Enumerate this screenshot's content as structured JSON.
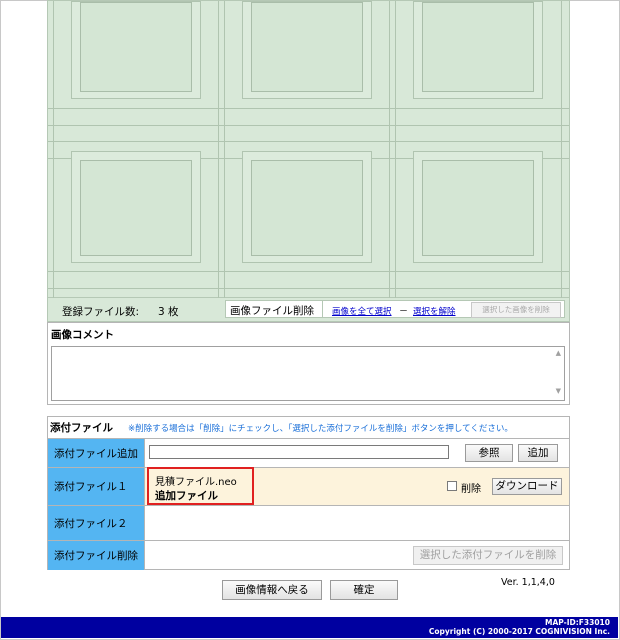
{
  "image_panel": {
    "count_label": "登録ファイル数:",
    "count_value": "3 枚",
    "delete_label": "画像ファイル削除",
    "select_all_link": "画像を全て選択",
    "separator": "－",
    "deselect_link": "選択を解除",
    "delete_selected_button": "選択した画像を削除"
  },
  "comment": {
    "title": "画像コメント",
    "value": ""
  },
  "attachments": {
    "title": "添付ファイル",
    "note": "※削除する場合は「削除」にチェックし、「選択した添付ファイルを削除」ボタンを押してください。",
    "add_row": {
      "label": "添付ファイル追加",
      "browse_button": "参照",
      "add_button": "追加"
    },
    "file1": {
      "label": "添付ファイル１",
      "file_name": "見積ファイル.neo",
      "tag": "追加ファイル",
      "delete_checkbox_label": "削除",
      "download_button": "ダウンロード"
    },
    "file2": {
      "label": "添付ファイル２"
    },
    "delete_row": {
      "label": "添付ファイル削除",
      "delete_button": "選択した添付ファイルを削除"
    }
  },
  "actions": {
    "back_button": "画像情報へ戻る",
    "confirm_button": "確定"
  },
  "version": "Ver. 1,1,4,0",
  "footer": {
    "map_id": "MAP-ID:F33010",
    "copyright": "Copyright (C) 2000-2017 COGNIVISION Inc."
  },
  "colors": {
    "label_bg": "#54b5f2",
    "highlight_row": "#fdf3dc",
    "footer_bg": "#0000a0",
    "link": "#0000cc"
  }
}
